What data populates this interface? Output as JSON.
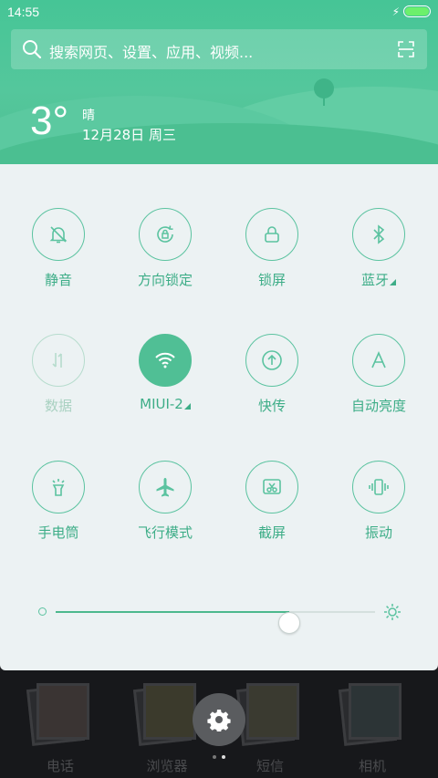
{
  "status_bar": {
    "time": "14:55",
    "battery_icon": "battery-icon",
    "charging_icon": "bolt-icon"
  },
  "search": {
    "placeholder": "搜索网页、设置、应用、视频...",
    "icon": "search-icon",
    "scan_icon": "scan-icon"
  },
  "weather": {
    "temperature": "3°",
    "condition": "晴",
    "date": "12月28日 周三"
  },
  "toggles": [
    {
      "label": "静音",
      "icon": "bell-off-icon",
      "state": "off",
      "has_more": false
    },
    {
      "label": "方向锁定",
      "icon": "rotation-lock-icon",
      "state": "off",
      "has_more": false
    },
    {
      "label": "锁屏",
      "icon": "lock-icon",
      "state": "off",
      "has_more": false
    },
    {
      "label": "蓝牙",
      "icon": "bluetooth-icon",
      "state": "off",
      "has_more": true
    },
    {
      "label": "数据",
      "icon": "mobile-data-icon",
      "state": "disabled",
      "has_more": false
    },
    {
      "label": "MIUI-2",
      "icon": "wifi-icon",
      "state": "on",
      "has_more": true
    },
    {
      "label": "快传",
      "icon": "quick-transfer-icon",
      "state": "off",
      "has_more": false
    },
    {
      "label": "自动亮度",
      "icon": "auto-brightness-icon",
      "state": "off",
      "has_more": false
    },
    {
      "label": "手电筒",
      "icon": "flashlight-icon",
      "state": "off",
      "has_more": false
    },
    {
      "label": "飞行模式",
      "icon": "airplane-icon",
      "state": "off",
      "has_more": false
    },
    {
      "label": "截屏",
      "icon": "screenshot-icon",
      "state": "off",
      "has_more": false
    },
    {
      "label": "振动",
      "icon": "vibrate-icon",
      "state": "off",
      "has_more": false
    }
  ],
  "brightness": {
    "level": 0.73
  },
  "home_apps": [
    {
      "label": "电话"
    },
    {
      "label": "浏览器"
    },
    {
      "label": "短信"
    },
    {
      "label": "相机"
    }
  ],
  "colors": {
    "accent": "#50bf95",
    "panel_bg": "#ecf2f3",
    "header": "#4fc394",
    "label": "#3dad87"
  }
}
